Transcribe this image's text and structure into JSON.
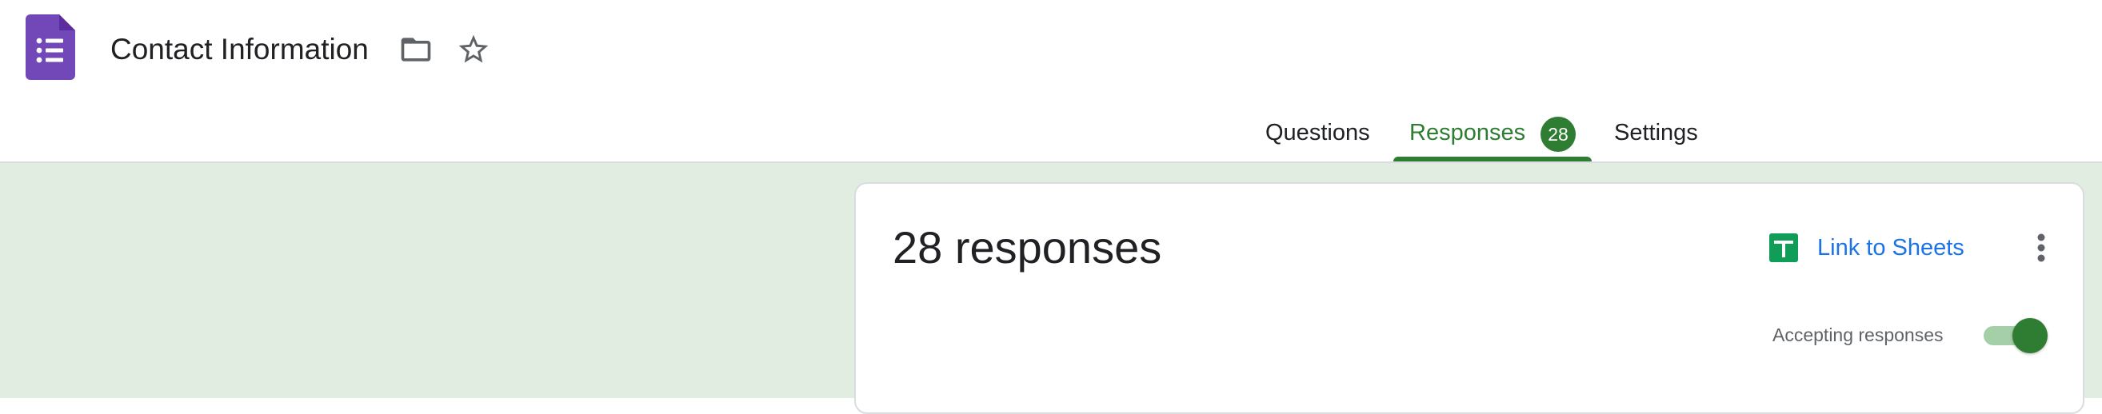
{
  "header": {
    "title": "Contact Information",
    "logo_icon": "google-forms-icon",
    "folder_icon": "folder-icon",
    "star_icon": "star-outline-icon"
  },
  "tabs": [
    {
      "label": "Questions",
      "active": false
    },
    {
      "label": "Responses",
      "active": true,
      "badge": "28"
    },
    {
      "label": "Settings",
      "active": false
    }
  ],
  "card": {
    "title": "28 responses",
    "link_to_sheets_label": "Link to Sheets",
    "sheets_icon": "google-sheets-icon",
    "more_icon": "more-vert-icon",
    "accepting_label": "Accepting responses",
    "accepting_responses": true
  },
  "colors": {
    "accent_green": "#2e7d32",
    "page_background": "#e1ede0",
    "forms_purple": "#7248b9",
    "link_blue": "#1a73e8",
    "sheets_green": "#0f9d58"
  }
}
